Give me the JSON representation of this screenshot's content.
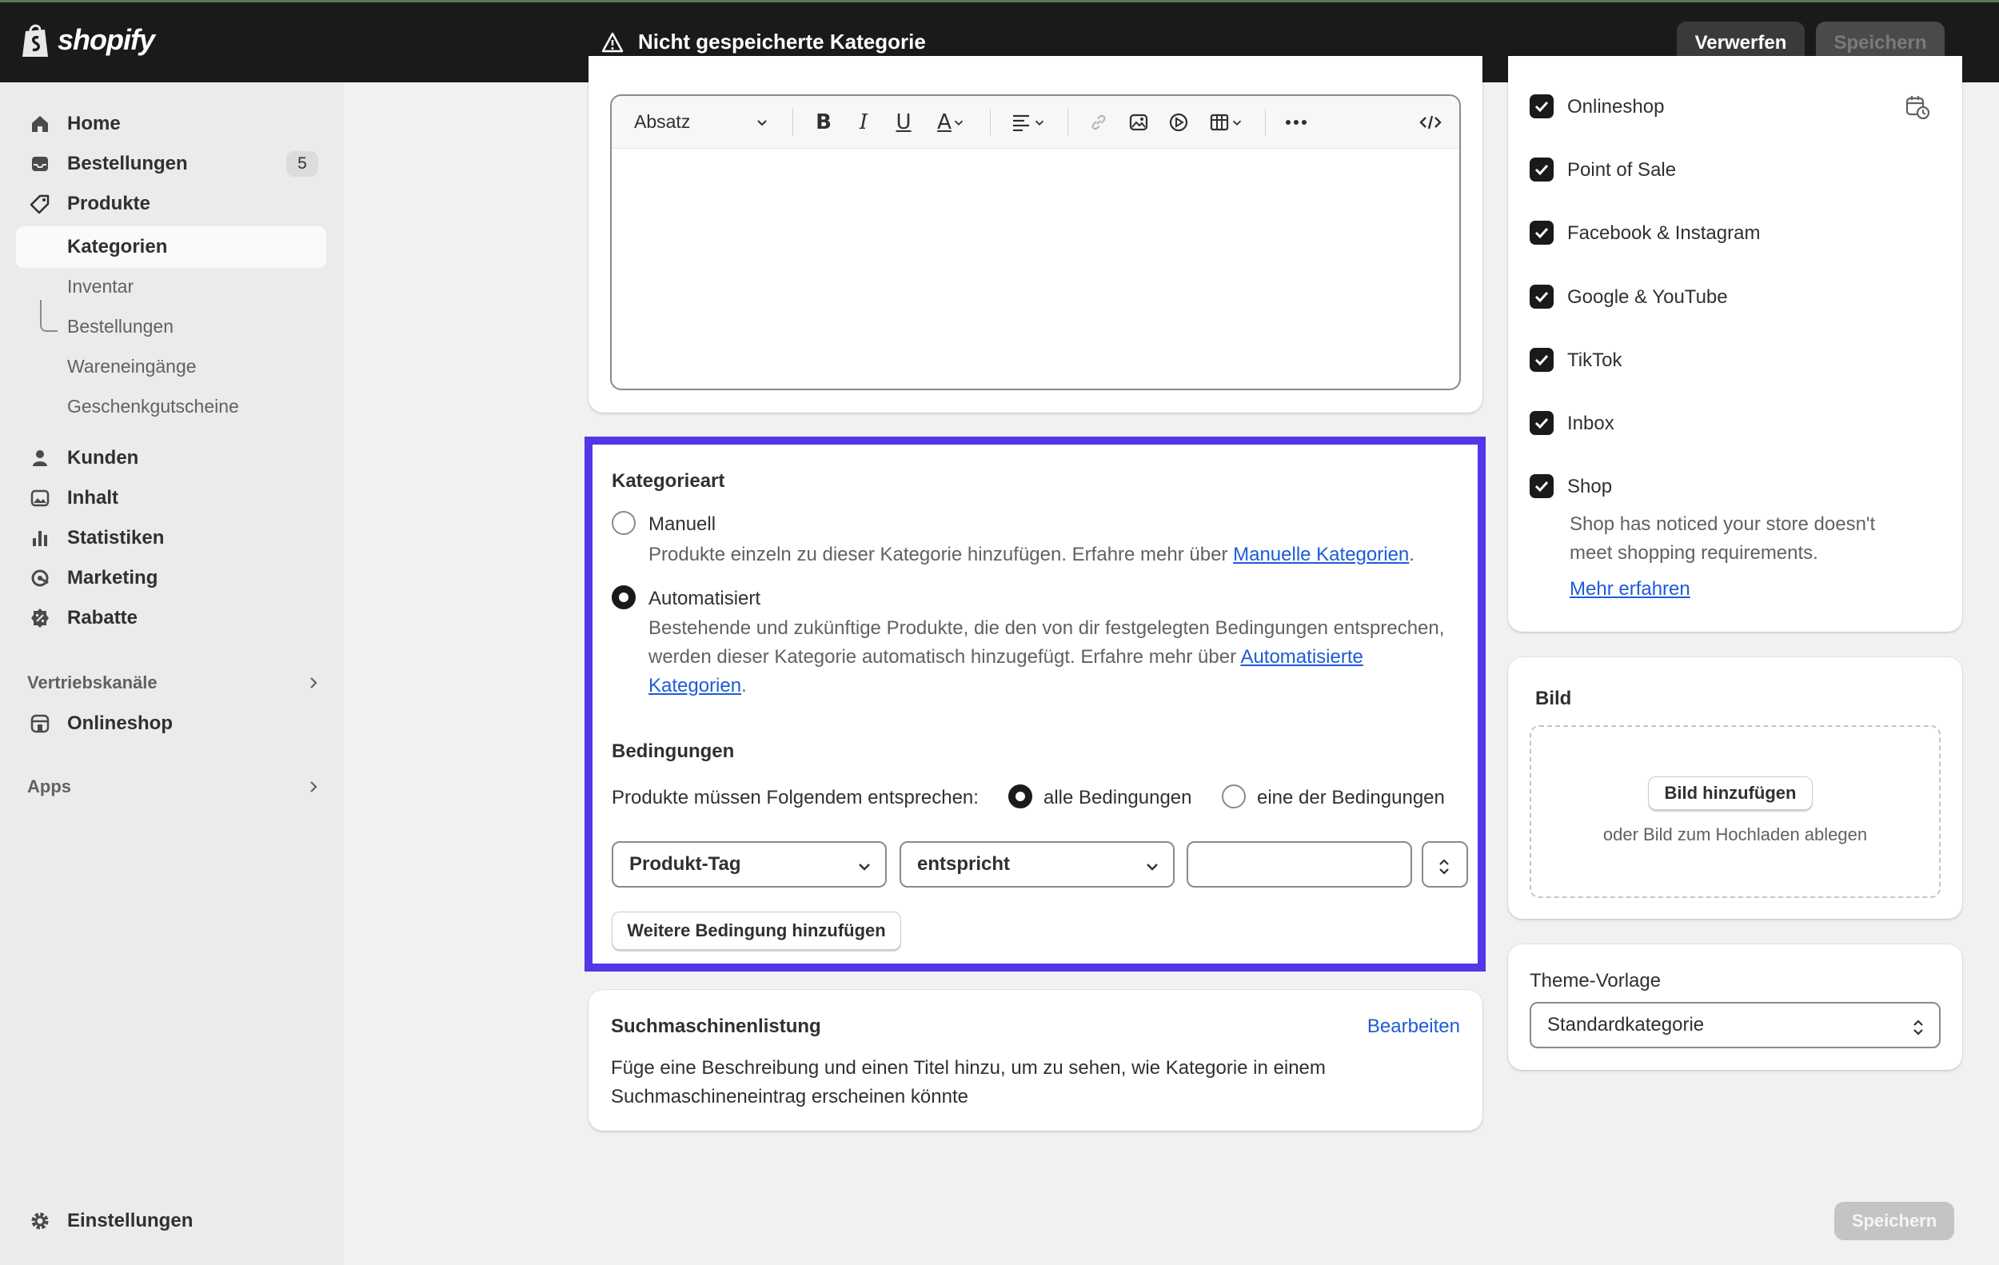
{
  "topbar": {
    "logo_text": "shopify",
    "unsaved_title": "Nicht gespeicherte Kategorie",
    "discard_label": "Verwerfen",
    "save_label": "Speichern"
  },
  "sidebar": {
    "items": [
      {
        "label": "Home",
        "icon": "home-icon"
      },
      {
        "label": "Bestellungen",
        "icon": "inbox-icon",
        "badge": "5"
      },
      {
        "label": "Produkte",
        "icon": "tag-icon"
      },
      {
        "label": "Kategorien"
      },
      {
        "label": "Inventar"
      },
      {
        "label": "Bestellungen"
      },
      {
        "label": "Wareneingänge"
      },
      {
        "label": "Geschenkgutscheine"
      },
      {
        "label": "Kunden",
        "icon": "person-icon"
      },
      {
        "label": "Inhalt",
        "icon": "image-icon"
      },
      {
        "label": "Statistiken",
        "icon": "bar-chart-icon"
      },
      {
        "label": "Marketing",
        "icon": "target-icon"
      },
      {
        "label": "Rabatte",
        "icon": "discount-icon"
      }
    ],
    "sales_channels_label": "Vertriebskanäle",
    "onlineshop_label": "Onlineshop",
    "apps_label": "Apps",
    "settings_label": "Einstellungen"
  },
  "editor": {
    "paragraph_select": "Absatz"
  },
  "category_type": {
    "title": "Kategorieart",
    "manual_label": "Manuell",
    "manual_desc": "Produkte einzeln zu dieser Kategorie hinzufügen. Erfahre mehr über ",
    "manual_link": "Manuelle Kategorien",
    "automated_label": "Automatisiert",
    "automated_desc": "Bestehende und zukünftige Produkte, die den von dir festgelegten Bedingungen entsprechen, werden dieser Kategorie automatisch hinzugefügt. Erfahre mehr über ",
    "automated_link": "Automatisierte Kategorien",
    "period": ".",
    "conditions_title": "Bedingungen",
    "match_prompt": "Produkte müssen Folgendem entsprechen:",
    "all_conditions": "alle Bedingungen",
    "any_condition": "eine der Bedingungen",
    "field_select": "Produkt-Tag",
    "operator_select": "entspricht",
    "value_input": "",
    "add_condition": "Weitere Bedingung hinzufügen"
  },
  "seo": {
    "title": "Suchmaschinenlistung",
    "edit_link": "Bearbeiten",
    "description": "Füge eine Beschreibung und einen Titel hinzu, um zu sehen, wie Kategorie in einem Suchmaschineneintrag erscheinen könnte"
  },
  "channels": {
    "items": [
      "Onlineshop",
      "Point of Sale",
      "Facebook & Instagram",
      "Google & YouTube",
      "TikTok",
      "Inbox",
      "Shop"
    ],
    "shop_notice": "Shop has noticed your store doesn't meet shopping requirements.",
    "learn_more": "Mehr erfahren"
  },
  "image_card": {
    "title": "Bild",
    "add_button": "Bild hinzufügen",
    "drop_hint": "oder Bild zum Hochladen ablegen"
  },
  "theme": {
    "label": "Theme-Vorlage",
    "value": "Standardkategorie"
  },
  "footer": {
    "save_label": "Speichern"
  }
}
